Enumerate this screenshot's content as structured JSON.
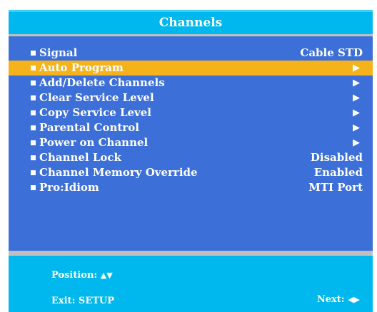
{
  "title": "Channels",
  "menu": {
    "items": [
      {
        "label": "Signal",
        "value": "Cable STD",
        "selected": false
      },
      {
        "label": "Auto Program",
        "value": "▶",
        "selected": true
      },
      {
        "label": "Add/Delete Channels",
        "value": "▶",
        "selected": false
      },
      {
        "label": "Clear Service Level",
        "value": "▶",
        "selected": false
      },
      {
        "label": "Copy Service Level",
        "value": "▶",
        "selected": false
      },
      {
        "label": "Parental Control",
        "value": "▶",
        "selected": false
      },
      {
        "label": "Power on Channel",
        "value": "▶",
        "selected": false
      },
      {
        "label": "Channel Lock",
        "value": "Disabled",
        "selected": false
      },
      {
        "label": "Channel Memory Override",
        "value": "Enabled",
        "selected": false
      },
      {
        "label": "Pro:Idiom",
        "value": "MTI Port",
        "selected": false
      }
    ]
  },
  "footer": {
    "position_label": "Position:",
    "position_arrows": "▲▼",
    "exit_label": "Exit: SETUP",
    "next_label": "Next:",
    "next_arrows": "◀▶"
  },
  "colors": {
    "title_bar": "#00b8ee",
    "menu_background": "#3c6fd8",
    "highlight": "#f6b21a",
    "divider": "#bfbfbf",
    "text": "#ffffff"
  },
  "icons": {
    "bullet": "square-bullet-icon",
    "submenu": "right-arrow-icon",
    "position": "up-down-arrows-icon",
    "next": "left-right-arrows-icon"
  }
}
